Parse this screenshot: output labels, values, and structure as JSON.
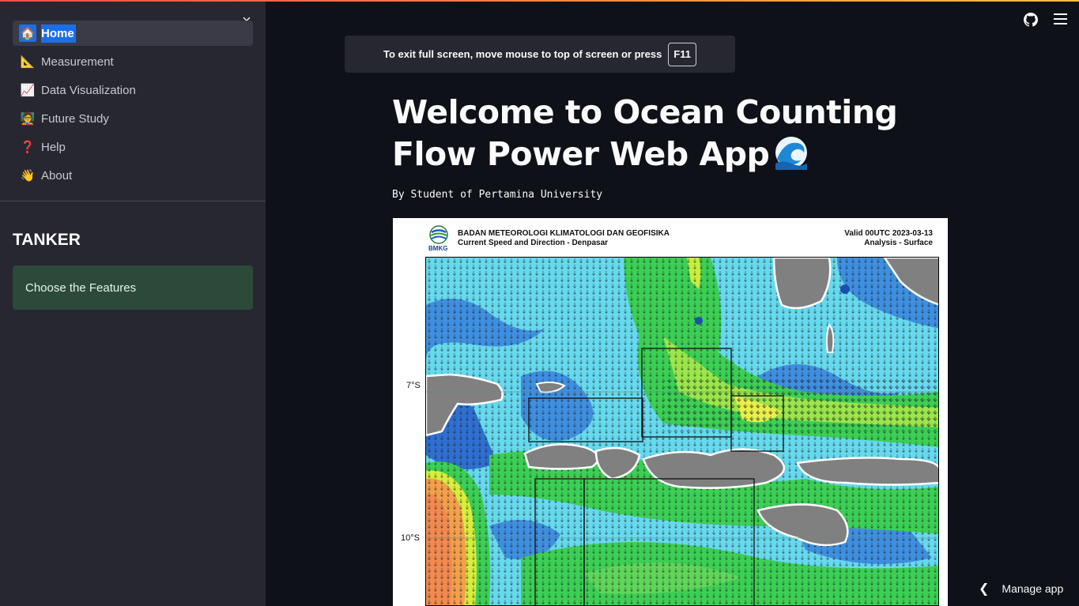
{
  "sidebar": {
    "items": [
      {
        "emoji": "🏠",
        "label": "Home",
        "active": true
      },
      {
        "emoji": "📐",
        "label": "Measurement",
        "active": false
      },
      {
        "emoji": "📈",
        "label": "Data Visualization",
        "active": false
      },
      {
        "emoji": "🧑‍🏫",
        "label": "Future Study",
        "active": false
      },
      {
        "emoji": "❓",
        "label": "Help",
        "active": false
      },
      {
        "emoji": "👋",
        "label": "About",
        "active": false
      }
    ],
    "close_icon": "×",
    "section_title": "TANKER",
    "info_box": "Choose the Features"
  },
  "fullscreen_notice": {
    "text": "To exit full screen, move mouse to top of screen or press",
    "key": "F11"
  },
  "main": {
    "title": "Welcome to Ocean Counting Flow Power Web App",
    "byline": "By Student of Pertamina University"
  },
  "map": {
    "agency": "BADAN METEOROLOGI KLIMATOLOGI DAN GEOFISIKA",
    "subtitle": "Current Speed and Direction - Denpasar",
    "valid": "Valid 00UTC 2023-03-13",
    "analysis": "Analysis - Surface",
    "logo_text": "BMKG",
    "lat_labels": [
      "7°S",
      "10°S"
    ]
  },
  "footer": {
    "manage_app": "Manage app"
  },
  "colors": {
    "background": "#0e1117",
    "sidebar": "#262730",
    "active": "#1c6ee8",
    "info_box": "#2b4a3a"
  },
  "icons": {
    "github": "github-icon",
    "menu": "hamburger-menu-icon",
    "close": "close-icon",
    "chevron": "chevron-left-icon"
  }
}
